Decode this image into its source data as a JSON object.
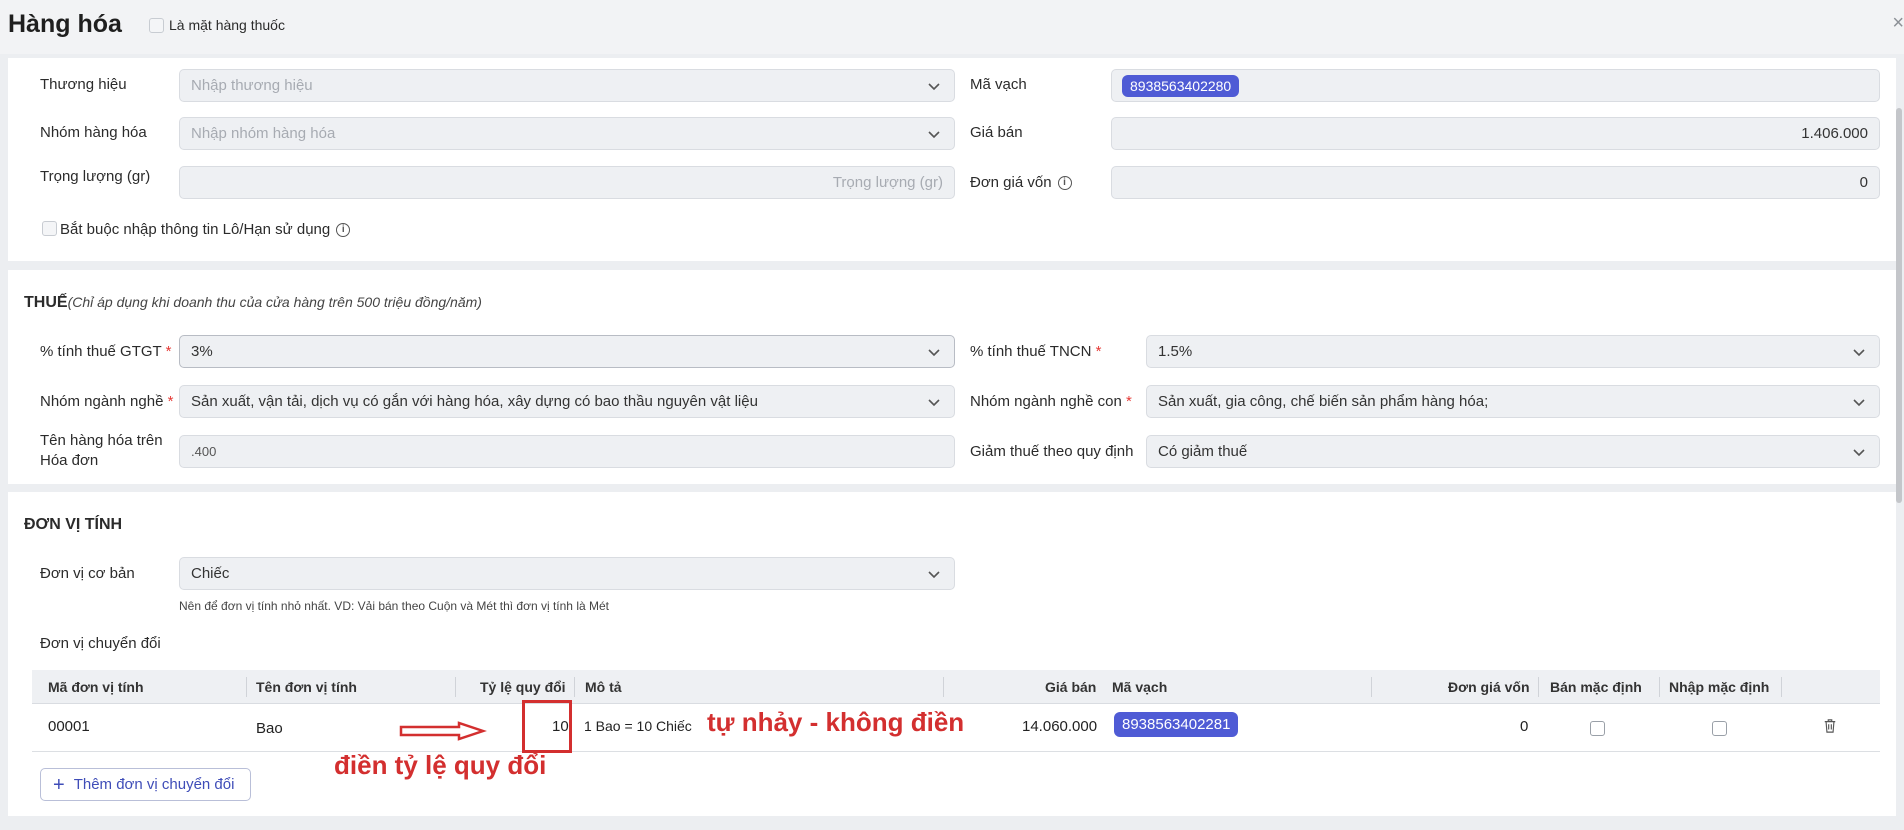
{
  "header": {
    "title": "Hàng hóa",
    "is_medicine_label": "Là mặt hàng thuốc",
    "close_glyph": "×"
  },
  "general": {
    "brand_label": "Thương hiệu",
    "brand_placeholder": "Nhập thương hiệu",
    "group_label": "Nhóm hàng hóa",
    "group_placeholder": "Nhập nhóm hàng hóa",
    "weight_label": "Trọng lượng (gr)",
    "weight_placeholder": "Trọng lượng (gr)",
    "barcode_label": "Mã vạch",
    "barcode_value": "8938563402280",
    "price_label": "Giá bán",
    "price_value": "1.406.000",
    "cost_label": "Đơn giá vốn",
    "cost_value": "0",
    "lot_required_label": "Bắt buộc nhập thông tin Lô/Hạn sử dụng"
  },
  "tax": {
    "title": "THUẾ",
    "note": "(Chỉ áp dụng khi doanh thu của cửa hàng trên 500 triệu đồng/năm)",
    "vat_label": "% tính thuế GTGT",
    "vat_value": "3%",
    "pit_label": "% tính thuế TNCN",
    "pit_value": "1.5%",
    "industry_label": "Nhóm ngành nghề",
    "industry_value": "Sản xuất, vận tải, dịch vụ có gắn với hàng hóa, xây dựng có bao thầu nguyên vật liệu",
    "sub_industry_label": "Nhóm ngành nghề con",
    "sub_industry_value": "Sản xuất, gia công, chế biến sản phẩm hàng hóa;",
    "invoice_name_label_1": "Tên hàng hóa trên",
    "invoice_name_label_2": "Hóa đơn",
    "invoice_name_value": ".400",
    "reduction_label": "Giảm thuế theo quy định",
    "reduction_value": "Có giảm thuế",
    "required_mark": "*"
  },
  "units": {
    "title": "ĐƠN VỊ TÍNH",
    "base_label": "Đơn vị cơ bản",
    "base_value": "Chiếc",
    "base_hint": "Nên để đơn vị tính nhỏ nhất. VD: Vải bán theo Cuộn và Mét thì đơn vị tính là Mét",
    "conversion_label": "Đơn vị chuyển đổi",
    "columns": [
      "Mã đơn vị tính",
      "Tên đơn vị tính",
      "Tỷ lệ quy đổi",
      "Mô tả",
      "Giá bán",
      "Mã vạch",
      "Đơn giá vốn",
      "Bán mặc định",
      "Nhập mặc định"
    ],
    "row": {
      "code": "00001",
      "name": "Bao",
      "ratio": "10",
      "description": "1 Bao = 10 Chiếc",
      "price": "14.060.000",
      "barcode": "8938563402281",
      "cost": "0"
    },
    "add_button": "Thêm đơn vị chuyển đổi"
  },
  "annotations": {
    "auto_fill": "tự nhảy - không điền",
    "enter_ratio": "điền tỷ lệ quy đổi"
  },
  "colors": {
    "accent": "#4f5bd5",
    "annotation_red": "#d32f2f",
    "required": "#e53935"
  }
}
